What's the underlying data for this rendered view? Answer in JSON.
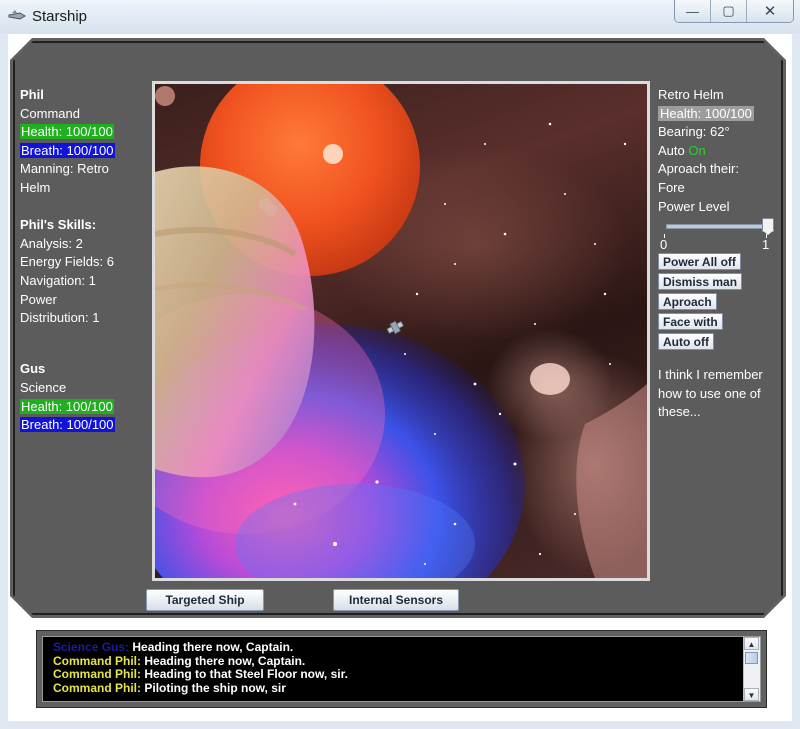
{
  "window": {
    "title": "Starship",
    "min_glyph": "—",
    "max_glyph": "▢",
    "close_glyph": "✕"
  },
  "crew": [
    {
      "name": "Phil",
      "role": "Command",
      "health": "Health: 100/100",
      "breath": "Breath: 100/100",
      "manning_line1": "Manning: Retro",
      "manning_line2": "Helm"
    },
    {
      "name": "Gus",
      "role": "Science",
      "health": "Health: 100/100",
      "breath": "Breath: 100/100"
    }
  ],
  "skills": {
    "title": "Phil's Skills:",
    "lines": [
      "Analysis: 2",
      "Energy Fields: 6",
      "Navigation: 1",
      "Power",
      "Distribution: 1"
    ]
  },
  "system": {
    "name": "Retro Helm",
    "health": "Health: 100/100",
    "bearing": "Bearing: 62°",
    "auto_label": "Auto",
    "auto_value": "On",
    "approach_line1": "Aproach their:",
    "approach_line2": "Fore",
    "power_label": "Power Level",
    "power_level": 1,
    "slider_min": "0",
    "slider_max": "1",
    "buttons": [
      "Power All off",
      "Dismiss man",
      "Aproach",
      "Face with",
      "Auto off"
    ],
    "note_lines": [
      "I think I remember",
      "how to use one of",
      "these..."
    ]
  },
  "tabs": {
    "targeted": "Targeted Ship",
    "internal": "Internal Sensors"
  },
  "log": [
    {
      "speaker": "Science Gus:",
      "kind": "science",
      "text": " Heading there now, Captain."
    },
    {
      "speaker": "Command Phil:",
      "kind": "command",
      "text": " Heading there now, Captain."
    },
    {
      "speaker": "Command Phil:",
      "kind": "command",
      "text": " Heading to that Steel Floor now, sir."
    },
    {
      "speaker": "Command Phil:",
      "kind": "command",
      "text": " Piloting the ship now, sir"
    }
  ],
  "colors": {
    "health": "#1faf1f",
    "breath": "#1212d8",
    "on": "#29d129",
    "science_speaker": "#1c1c9c",
    "command_speaker": "#e4e44a"
  }
}
